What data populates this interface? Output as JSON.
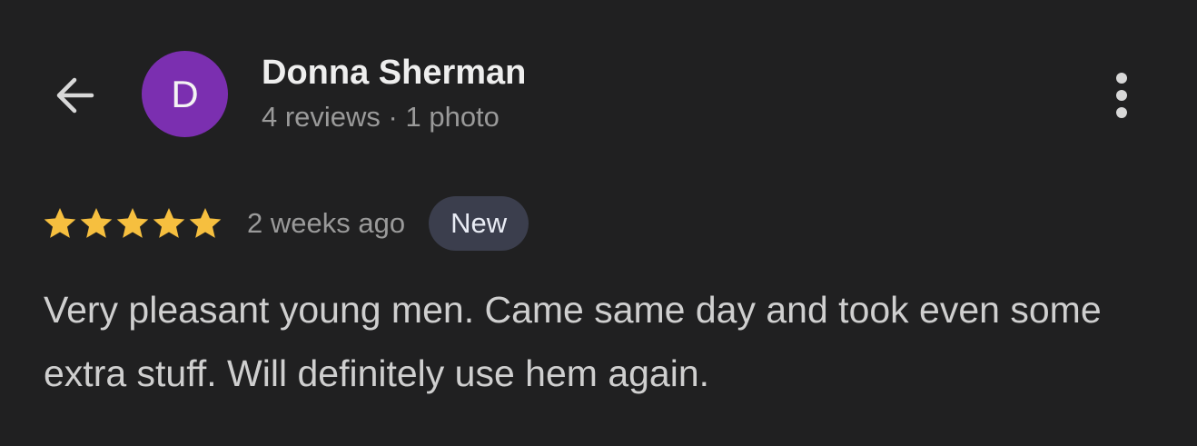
{
  "header": {
    "back_icon": "arrow-left-icon",
    "avatar_initial": "D",
    "avatar_color": "#7b2fb0",
    "reviewer_name": "Donna Sherman",
    "reviewer_meta": "4 reviews · 1 photo",
    "more_icon": "more-vert-icon"
  },
  "review": {
    "rating": 5,
    "rating_max": 5,
    "star_color": "#f6bf3f",
    "time_ago": "2 weeks ago",
    "badge": "New",
    "text": "Very pleasant young men. Came same day and took even some extra stuff. Will definitely use hem again."
  }
}
